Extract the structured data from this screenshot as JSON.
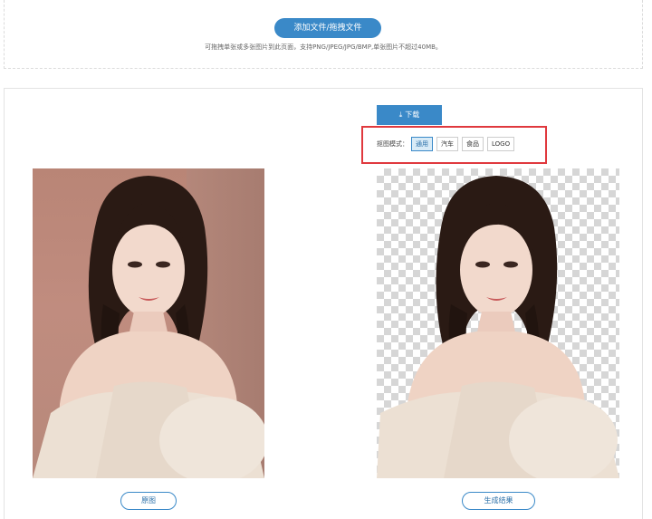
{
  "upload": {
    "button_label": "添加文件/拖拽文件",
    "hint": "可拖拽单张或多张图片到此页面，支持PNG/JPEG/JPG/BMP,单张图片不超过40MB。"
  },
  "toolbar": {
    "download_icon": "download-icon",
    "download_label": "下载"
  },
  "mode": {
    "label": "抠图模式：",
    "options": [
      "通用",
      "汽车",
      "食品",
      "LOGO"
    ],
    "selected": "通用"
  },
  "images": {
    "original_label": "原图",
    "result_label": "生成结果"
  },
  "colors": {
    "accent": "#3a89c8",
    "highlight_border": "#e0393e",
    "active_option_bg": "#d8ebf7"
  }
}
